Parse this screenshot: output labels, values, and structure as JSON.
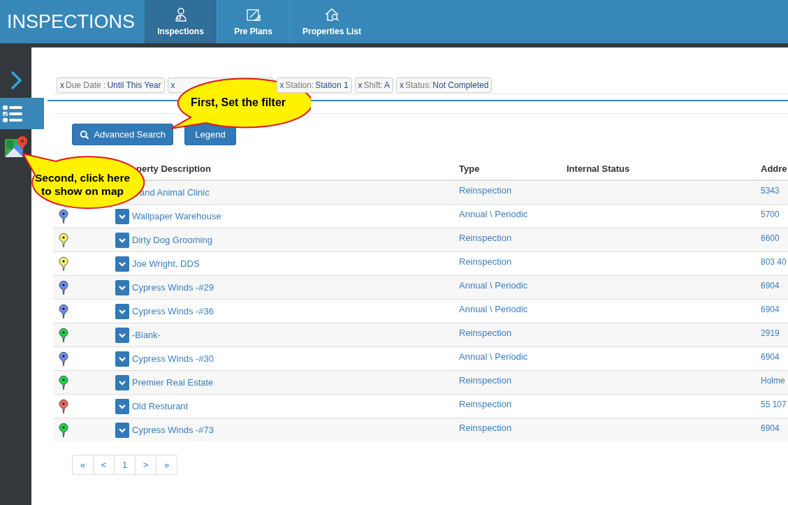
{
  "app_title": "INSPECTIONS",
  "nav_tabs": [
    {
      "label": "Inspections",
      "selected": true
    },
    {
      "label": "Pre Plans",
      "selected": false
    },
    {
      "label": "Properties List",
      "selected": false
    }
  ],
  "sidebar": [
    {
      "kind": "expand",
      "selected": false
    },
    {
      "kind": "list",
      "selected": true
    },
    {
      "kind": "map",
      "selected": false
    }
  ],
  "filters": [
    {
      "remove": "x",
      "label": "Due Date :",
      "value": "Until This Year"
    },
    {
      "remove": "x"
    },
    {
      "remove": "x",
      "label": "Station:",
      "value": "Station 1"
    },
    {
      "remove": "x",
      "label": "Shift:",
      "value": "A"
    },
    {
      "remove": "x",
      "label": "Status:",
      "value": "Not Completed"
    }
  ],
  "buttons": [
    {
      "label": "Advanced Search"
    },
    {
      "label": "Legend"
    }
  ],
  "table": {
    "columns": [
      "perty Description",
      "Type",
      "Internal Status",
      "Addre"
    ],
    "rows": [
      {
        "name": "and Animal Clinic",
        "type": "Reinspection",
        "address": "5343"
      },
      {
        "color": "#6a8cf0",
        "name": "Wallpaper Warehouse",
        "type": "Annual \\ Periodic",
        "address": "5700"
      },
      {
        "color": "#f5ef6b",
        "name": "Dirty Dog Grooming",
        "type": "Reinspection",
        "address": "6600"
      },
      {
        "color": "#f5ef6b",
        "name": "Joe Wright, DDS",
        "type": "Reinspection",
        "address": "803 40"
      },
      {
        "color": "#6a8cf0",
        "name": "Cypress Winds -#29",
        "type": "Annual \\ Periodic",
        "address": "6904"
      },
      {
        "color": "#6a8cf0",
        "name": "Cypress Winds -#36",
        "type": "Annual \\ Periodic",
        "address": "6904"
      },
      {
        "color": "#1fd34a",
        "name": "-Blank-",
        "type": "Reinspection",
        "address": "2919"
      },
      {
        "color": "#6a8cf0",
        "name": "Cypress Winds -#30",
        "type": "Annual \\ Periodic",
        "address": "6904"
      },
      {
        "color": "#1fd34a",
        "name": "Premier Real Estate",
        "type": "Reinspection",
        "address": "Holme"
      },
      {
        "color": "#f26b5b",
        "name": "Old Resturant",
        "type": "Reinspection",
        "address": "55 107"
      },
      {
        "color": "#1fd34a",
        "name": "Cypress Winds -#73",
        "type": "Reinspection",
        "address": "6904"
      }
    ]
  },
  "pagination": [
    {
      "label": "«",
      "selected": false
    },
    {
      "label": "<",
      "selected": false
    },
    {
      "label": "1",
      "selected": false
    },
    {
      "label": ">",
      "selected": false
    },
    {
      "label": "»",
      "selected": false
    }
  ],
  "callouts": [
    {
      "kind": "filter",
      "text": "First, Set the filter"
    },
    {
      "kind": "map",
      "text": "Second, click here to show on map"
    }
  ]
}
